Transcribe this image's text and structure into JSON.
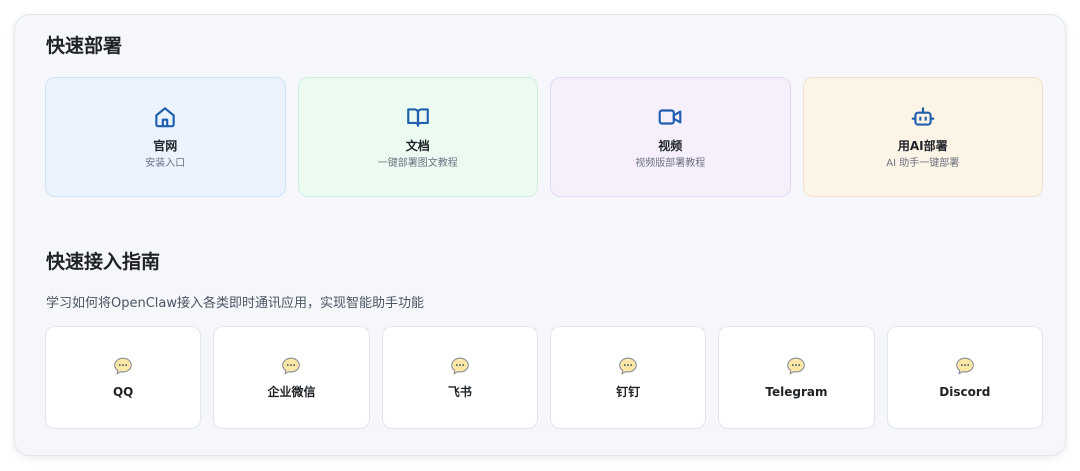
{
  "quick_deploy": {
    "title": "快速部署",
    "accent_color": "#1f5fae",
    "cards": [
      {
        "icon": "home-icon",
        "title": "官网",
        "desc": "安装入口",
        "color": "#eaf3fe"
      },
      {
        "icon": "book-icon",
        "title": "文档",
        "desc": "一键部署图文教程",
        "color": "#ecfbf2"
      },
      {
        "icon": "video-icon",
        "title": "视频",
        "desc": "视频版部署教程",
        "color": "#f6f0fd"
      },
      {
        "icon": "robot-icon",
        "title": "用AI部署",
        "desc": "AI 助手一键部署",
        "color": "#fdf4e8"
      }
    ]
  },
  "quick_guide": {
    "title": "快速接入指南",
    "subtitle": "学习如何将OpenClaw接入各类即时通讯应用，实现智能助手功能",
    "items": [
      {
        "icon": "chat-bubble-icon",
        "name": "QQ"
      },
      {
        "icon": "chat-bubble-icon",
        "name": "企业微信"
      },
      {
        "icon": "chat-bubble-icon",
        "name": "飞书"
      },
      {
        "icon": "chat-bubble-icon",
        "name": "钉钉"
      },
      {
        "icon": "chat-bubble-icon",
        "name": "Telegram"
      },
      {
        "icon": "chat-bubble-icon",
        "name": "Discord"
      }
    ]
  }
}
